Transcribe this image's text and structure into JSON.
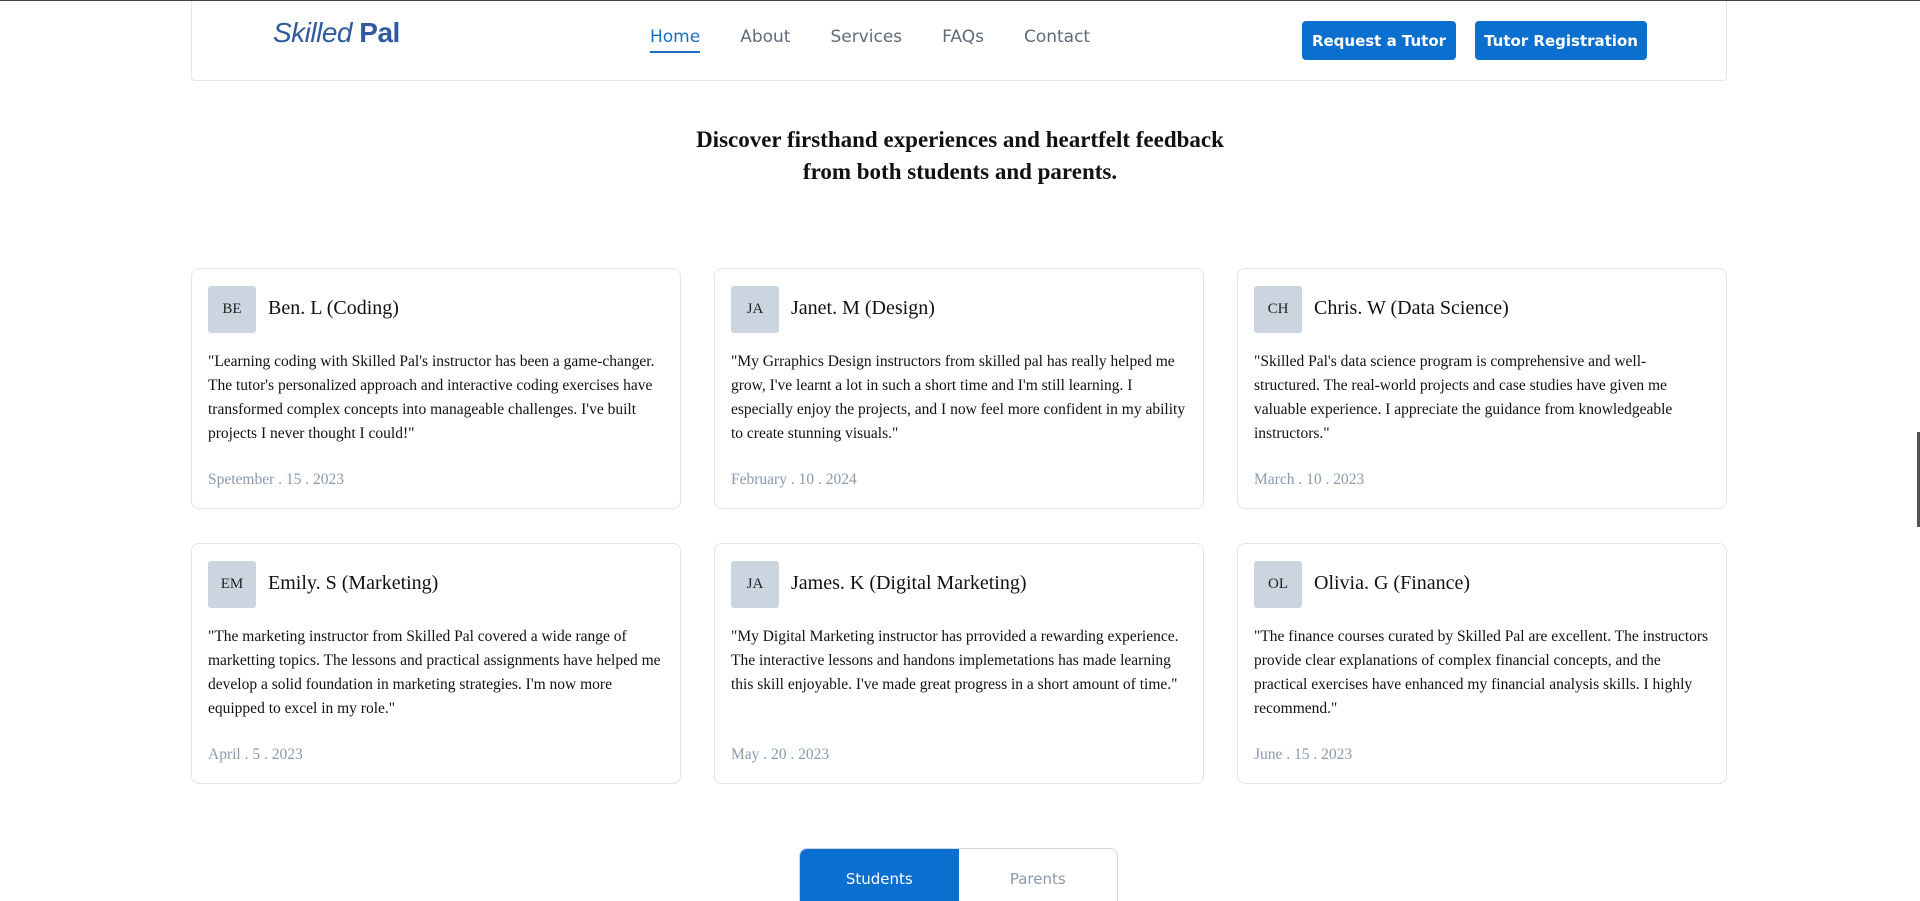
{
  "brand": {
    "logo_part1": "Skilled",
    "logo_part2": "Pal"
  },
  "nav": {
    "links": [
      "Home",
      "About",
      "Services",
      "FAQs",
      "Contact"
    ],
    "active": "Home",
    "request_button": "Request a Tutor",
    "register_button": "Tutor Registration"
  },
  "headline": {
    "line1": "Discover firsthand experiences and heartfelt feedback",
    "line2": "from both students and parents."
  },
  "testimonials": [
    {
      "initials": "BE",
      "name": "Ben. L (Coding)",
      "quote": "\"Learning coding with Skilled Pal's instructor has been a game-changer. The tutor's personalized approach and interactive coding exercises have transformed complex concepts into manageable challenges. I've built projects I never thought I could!\"",
      "date": "Spetember . 15 . 2023"
    },
    {
      "initials": "JA",
      "name": "Janet. M (Design)",
      "quote": "\"My Grraphics Design instructors from skilled pal has really helped me grow, I've learnt a lot in such a short time and I'm still learning. I especially enjoy the projects, and I now feel more confident in my ability to create stunning visuals.\"",
      "date": "February . 10 . 2024"
    },
    {
      "initials": "CH",
      "name": "Chris. W (Data Science)",
      "quote": "\"Skilled Pal's data science program is comprehensive and well-structured. The real-world projects and case studies have given me valuable experience. I appreciate the guidance from knowledgeable instructors.\"",
      "date": "March . 10 . 2023"
    },
    {
      "initials": "EM",
      "name": "Emily. S (Marketing)",
      "quote": "\"The marketing instructor from Skilled Pal covered a wide range of marketting topics. The lessons and practical assignments have helped me develop a solid foundation in marketing strategies. I'm now more equipped to excel in my role.\"",
      "date": "April . 5 . 2023"
    },
    {
      "initials": "JA",
      "name": "James. K (Digital Marketing)",
      "quote": "\"My Digital Marketing instructor has prrovided a rewarding experience. The interactive lessons and handons implemetations has made learning this skill enjoyable. I've made great progress in a short amount of time.\"",
      "date": "May . 20 . 2023"
    },
    {
      "initials": "OL",
      "name": "Olivia. G (Finance)",
      "quote": "\"The finance courses curated by Skilled Pal are excellent. The instructors provide clear explanations of complex financial concepts, and the practical exercises have enhanced my financial analysis skills. I highly recommend.\"",
      "date": "June . 15 . 2023"
    }
  ],
  "toggle": {
    "students": "Students",
    "parents": "Parents",
    "selected": "Students"
  },
  "colors": {
    "primary": "#0b6fd0",
    "logo": "#2f5aa0",
    "date_text": "#8a99b0",
    "avatar_bg": "#cbd5df"
  }
}
